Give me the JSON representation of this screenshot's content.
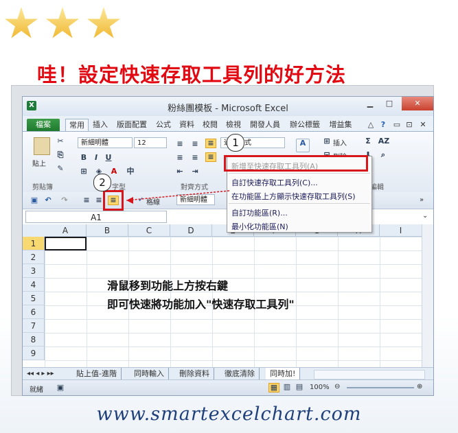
{
  "headline": "哇！設定快速存取工具列的好方法",
  "window": {
    "logo": "X",
    "title": "粉絲團模板 - Microsoft Excel",
    "btn_min": "▁",
    "btn_max": "□",
    "btn_close": "✕"
  },
  "tabs": [
    "檔案",
    "常用",
    "插入",
    "版面配置",
    "公式",
    "資料",
    "校閱",
    "檢視",
    "開發人員",
    "辦公標籤",
    "增益集"
  ],
  "tab_right_icons": [
    "△",
    "?",
    "▭",
    "⊡",
    "✕"
  ],
  "ribbon": {
    "paste_label": "貼上",
    "font_name": "新細明體",
    "font_size": "12",
    "bold": "B",
    "italic": "I",
    "underline": "U",
    "number_format": "通用格式",
    "insert_label": "插入",
    "delete_label": "刪除",
    "sum": "Σ",
    "sort": "AZ",
    "group_clipboard": "剪貼簿",
    "group_font": "字型",
    "group_align": "對齊方式",
    "group_edit": "編輯",
    "percent": "%"
  },
  "qat": {
    "label_format": "格線",
    "font_name": "新細明體"
  },
  "formula_bar": {
    "namebox": "A1"
  },
  "columns": [
    "A",
    "B",
    "C",
    "D",
    "E",
    "F",
    "G",
    "H",
    "I"
  ],
  "rows": [
    "1",
    "2",
    "3",
    "4",
    "5",
    "6",
    "7",
    "8",
    "9"
  ],
  "sheet_tabs": [
    "貼上值-進階",
    "同時輸入",
    "刪除資料",
    "徹底清除",
    "同時加!"
  ],
  "status": {
    "ready": "就緒",
    "zoom": "100%"
  },
  "context_menu": {
    "items": [
      {
        "label": "新增至快速存取工具列(A)",
        "disabled": true
      },
      {
        "label": "自訂快速存取工具列(C)...",
        "disabled": false
      },
      {
        "label": "在功能區上方顯示快速存取工具列(S)",
        "disabled": false
      },
      {
        "label": "自訂功能區(R)...",
        "disabled": false
      },
      {
        "label": "最小化功能區(N)",
        "disabled": false
      }
    ]
  },
  "badges": {
    "one": "1",
    "two": "2"
  },
  "instructions": {
    "line1": "滑鼠移到功能上方按右鍵",
    "line2": "即可快速將功能加入\"快速存取工具列\""
  },
  "website": "www.smartexcelchart.com",
  "colors": {
    "accent_red": "#e20a12",
    "excel_green": "#1f7a2e",
    "highlight": "#ffd76a"
  }
}
